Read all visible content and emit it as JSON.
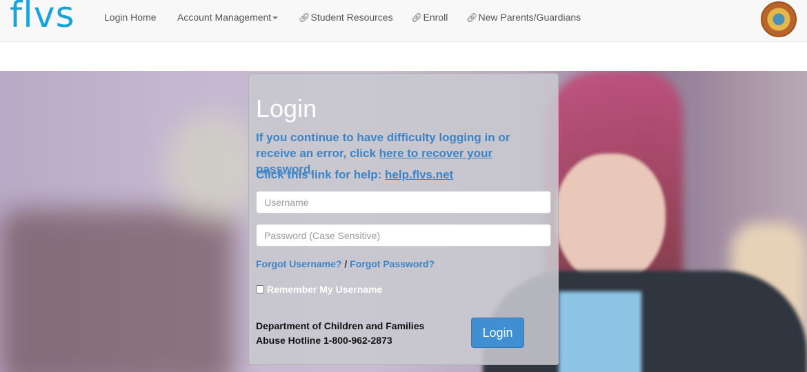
{
  "brand": {
    "logo_text": "flvs",
    "logo_color": "#1aa3d9"
  },
  "nav": {
    "items": [
      {
        "label": "Login Home"
      },
      {
        "label": "Account Management"
      },
      {
        "label": "Student Resources"
      },
      {
        "label": "Enroll"
      },
      {
        "label": "New Parents/Guardians"
      }
    ],
    "link_icon": "link-icon",
    "seal_icon": "florida-seal-icon"
  },
  "login": {
    "title": "Login",
    "notice_prefix": "If you continue to have difficulty logging in or receive an error, click ",
    "notice_link": "here to recover your password.",
    "help_prefix": "Click this link for help: ",
    "help_link": "help.flvs.net",
    "username_placeholder": "Username",
    "password_placeholder": "Password (Case Sensitive)",
    "forgot_username": "Forgot Username?",
    "forgot_separator": "/",
    "forgot_password": "Forgot Password?",
    "remember_label": "Remember My Username",
    "remember_checked": false,
    "button_label": "Login",
    "accent_color": "#3c84c8"
  },
  "footer_note": {
    "line1": "Department of Children and Families",
    "line2": "Abuse Hotline 1-800-962-2873"
  }
}
